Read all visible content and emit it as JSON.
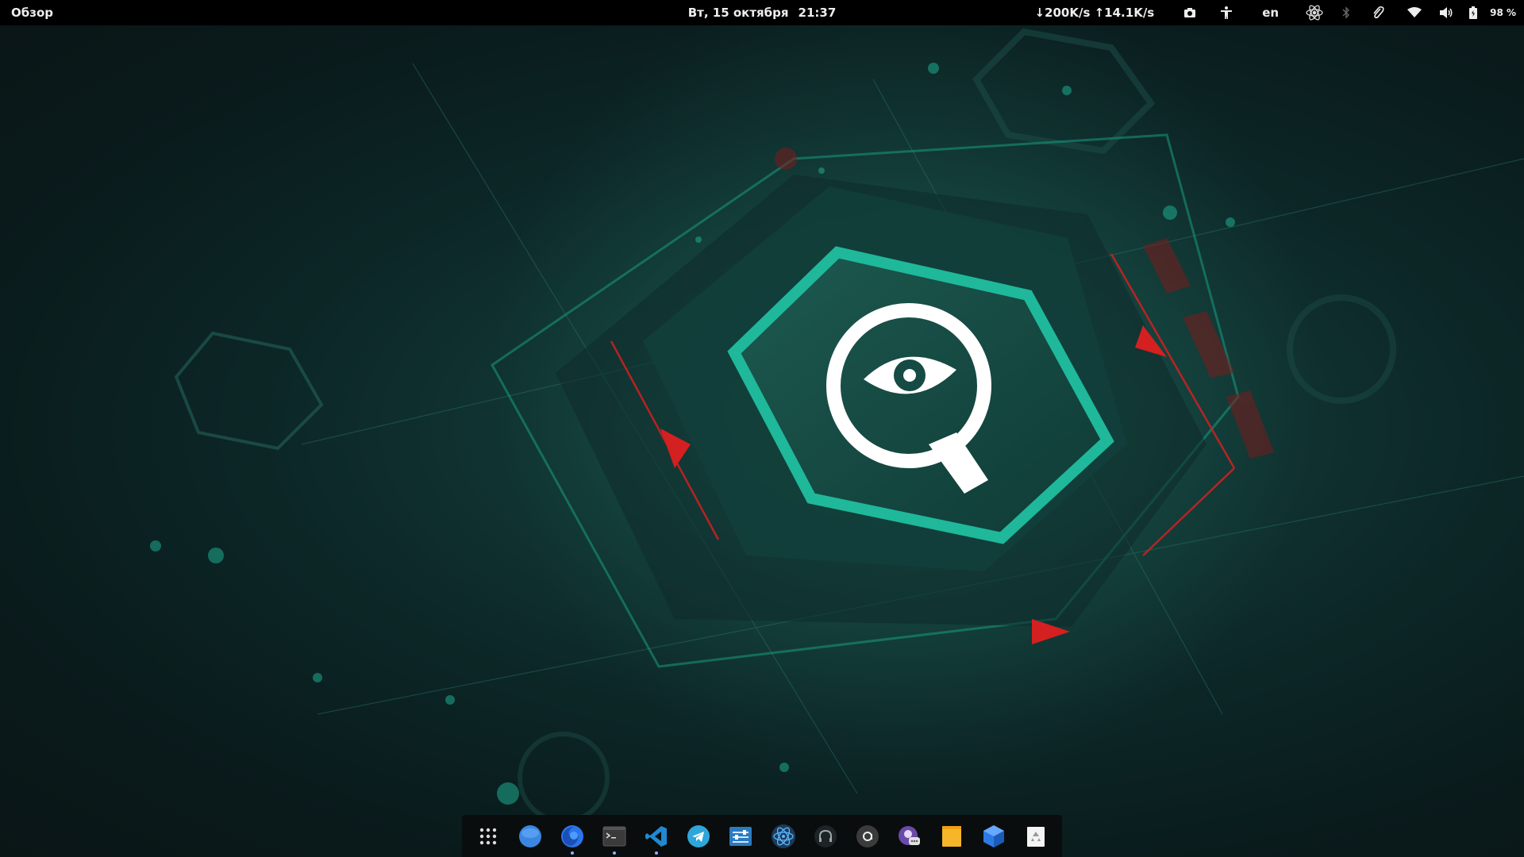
{
  "topbar": {
    "overview_label": "Обзор",
    "date": "Вт, 15 октября",
    "time": "21:37",
    "network_speed": "↓200K/s ↑14.1K/s",
    "language": "en",
    "battery_percent": "98 %"
  },
  "tray_icons": [
    "screenshot-icon",
    "accessibility-icon",
    "atom-icon",
    "bluetooth-icon",
    "paperclip-icon",
    "wifi-icon",
    "volume-icon",
    "battery-icon"
  ],
  "dock": {
    "items": [
      {
        "name": "show-apps",
        "running": false
      },
      {
        "name": "web-browser",
        "running": false
      },
      {
        "name": "firefox",
        "running": true
      },
      {
        "name": "terminal",
        "running": true
      },
      {
        "name": "visual-studio-code",
        "running": true
      },
      {
        "name": "telegram",
        "running": false
      },
      {
        "name": "settings-app",
        "running": false
      },
      {
        "name": "atom-editor",
        "running": false
      },
      {
        "name": "headphones-app",
        "running": false
      },
      {
        "name": "at-sign-app",
        "running": false
      },
      {
        "name": "chat-app",
        "running": false
      },
      {
        "name": "sticky-notes",
        "running": false
      },
      {
        "name": "package-box",
        "running": false
      },
      {
        "name": "trash",
        "running": false
      }
    ]
  },
  "colors": {
    "accent_teal": "#1fb89a",
    "warning_red": "#d42020",
    "topbar_bg": "#000000",
    "dock_bg": "#0a0d0e"
  }
}
